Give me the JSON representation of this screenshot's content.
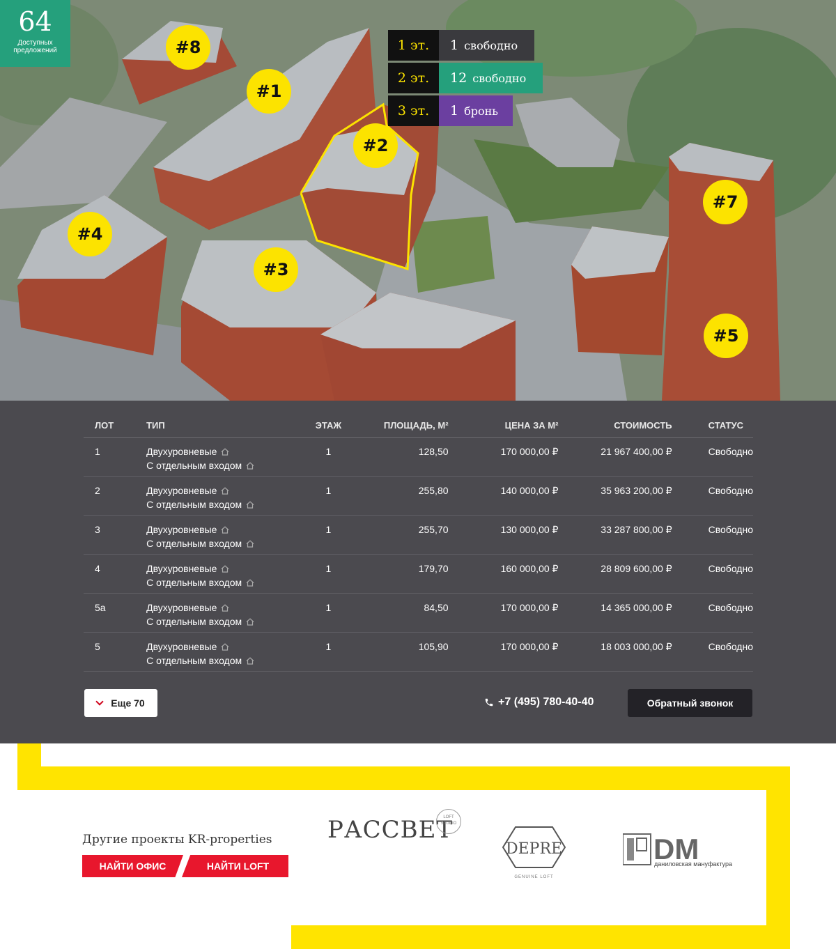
{
  "hero": {
    "offers_count": "64",
    "offers_label": "Доступных предложений",
    "buildings": [
      "#8",
      "#1",
      "#2",
      "#7",
      "#4",
      "#3",
      "#5"
    ],
    "floors": [
      {
        "floor": "1 эт.",
        "count": "1",
        "status": "свободно",
        "color": "#3a3a3e"
      },
      {
        "floor": "2 эт.",
        "count": "12",
        "status": "свободно",
        "color": "#25a07c"
      },
      {
        "floor": "3 эт.",
        "count": "1",
        "status": "бронь",
        "color": "#6b3fa0"
      }
    ]
  },
  "table": {
    "headers": {
      "lot": "ЛОТ",
      "type": "ТИП",
      "floor": "ЭТАЖ",
      "area": "ПЛОЩАДЬ, М²",
      "price": "ЦЕНА ЗА М²",
      "cost": "СТОИМОСТЬ",
      "status": "СТАТУС"
    },
    "rows": [
      {
        "lot": "1",
        "type1": "Двухуровневые",
        "type2": "С отдельным входом",
        "floor": "1",
        "area": "128,50",
        "price": "170 000,00 ₽",
        "cost": "21 967 400,00 ₽",
        "status": "Свободно"
      },
      {
        "lot": "2",
        "type1": "Двухуровневые",
        "type2": "С отдельным входом",
        "floor": "1",
        "area": "255,80",
        "price": "140 000,00 ₽",
        "cost": "35 963 200,00 ₽",
        "status": "Свободно"
      },
      {
        "lot": "3",
        "type1": "Двухуровневые",
        "type2": "С отдельным входом",
        "floor": "1",
        "area": "255,70",
        "price": "130 000,00 ₽",
        "cost": "33 287 800,00 ₽",
        "status": "Свободно"
      },
      {
        "lot": "4",
        "type1": "Двухуровневые",
        "type2": "С отдельным входом",
        "floor": "1",
        "area": "179,70",
        "price": "160 000,00 ₽",
        "cost": "28 809 600,00 ₽",
        "status": "Свободно"
      },
      {
        "lot": "5а",
        "type1": "Двухуровневые",
        "type2": "С отдельным входом",
        "floor": "1",
        "area": "84,50",
        "price": "170 000,00 ₽",
        "cost": "14 365 000,00 ₽",
        "status": "Свободно"
      },
      {
        "lot": "5",
        "type1": "Двухуровневые",
        "type2": "С отдельным входом",
        "floor": "1",
        "area": "105,90",
        "price": "170 000,00 ₽",
        "cost": "18 003 000,00 ₽",
        "status": "Свободно"
      }
    ],
    "more_label": "Еще 70",
    "phone": "+7 (495) 780-40-40",
    "callback_label": "Обратный звонок"
  },
  "footer": {
    "other_projects_title": "Другие проекты KR-properties",
    "find_office": "НАЙТИ ОФИС",
    "find_loft": "НАЙТИ LOFT",
    "logos": {
      "rassvet": "РАССВЕТ",
      "rassvet_badge": "LOFT STUDIO",
      "depre": "DEPRE",
      "depre_sub": "GENUINE LOFT",
      "dm": "DM",
      "dm_sub": "даниловская мануфактура"
    }
  }
}
